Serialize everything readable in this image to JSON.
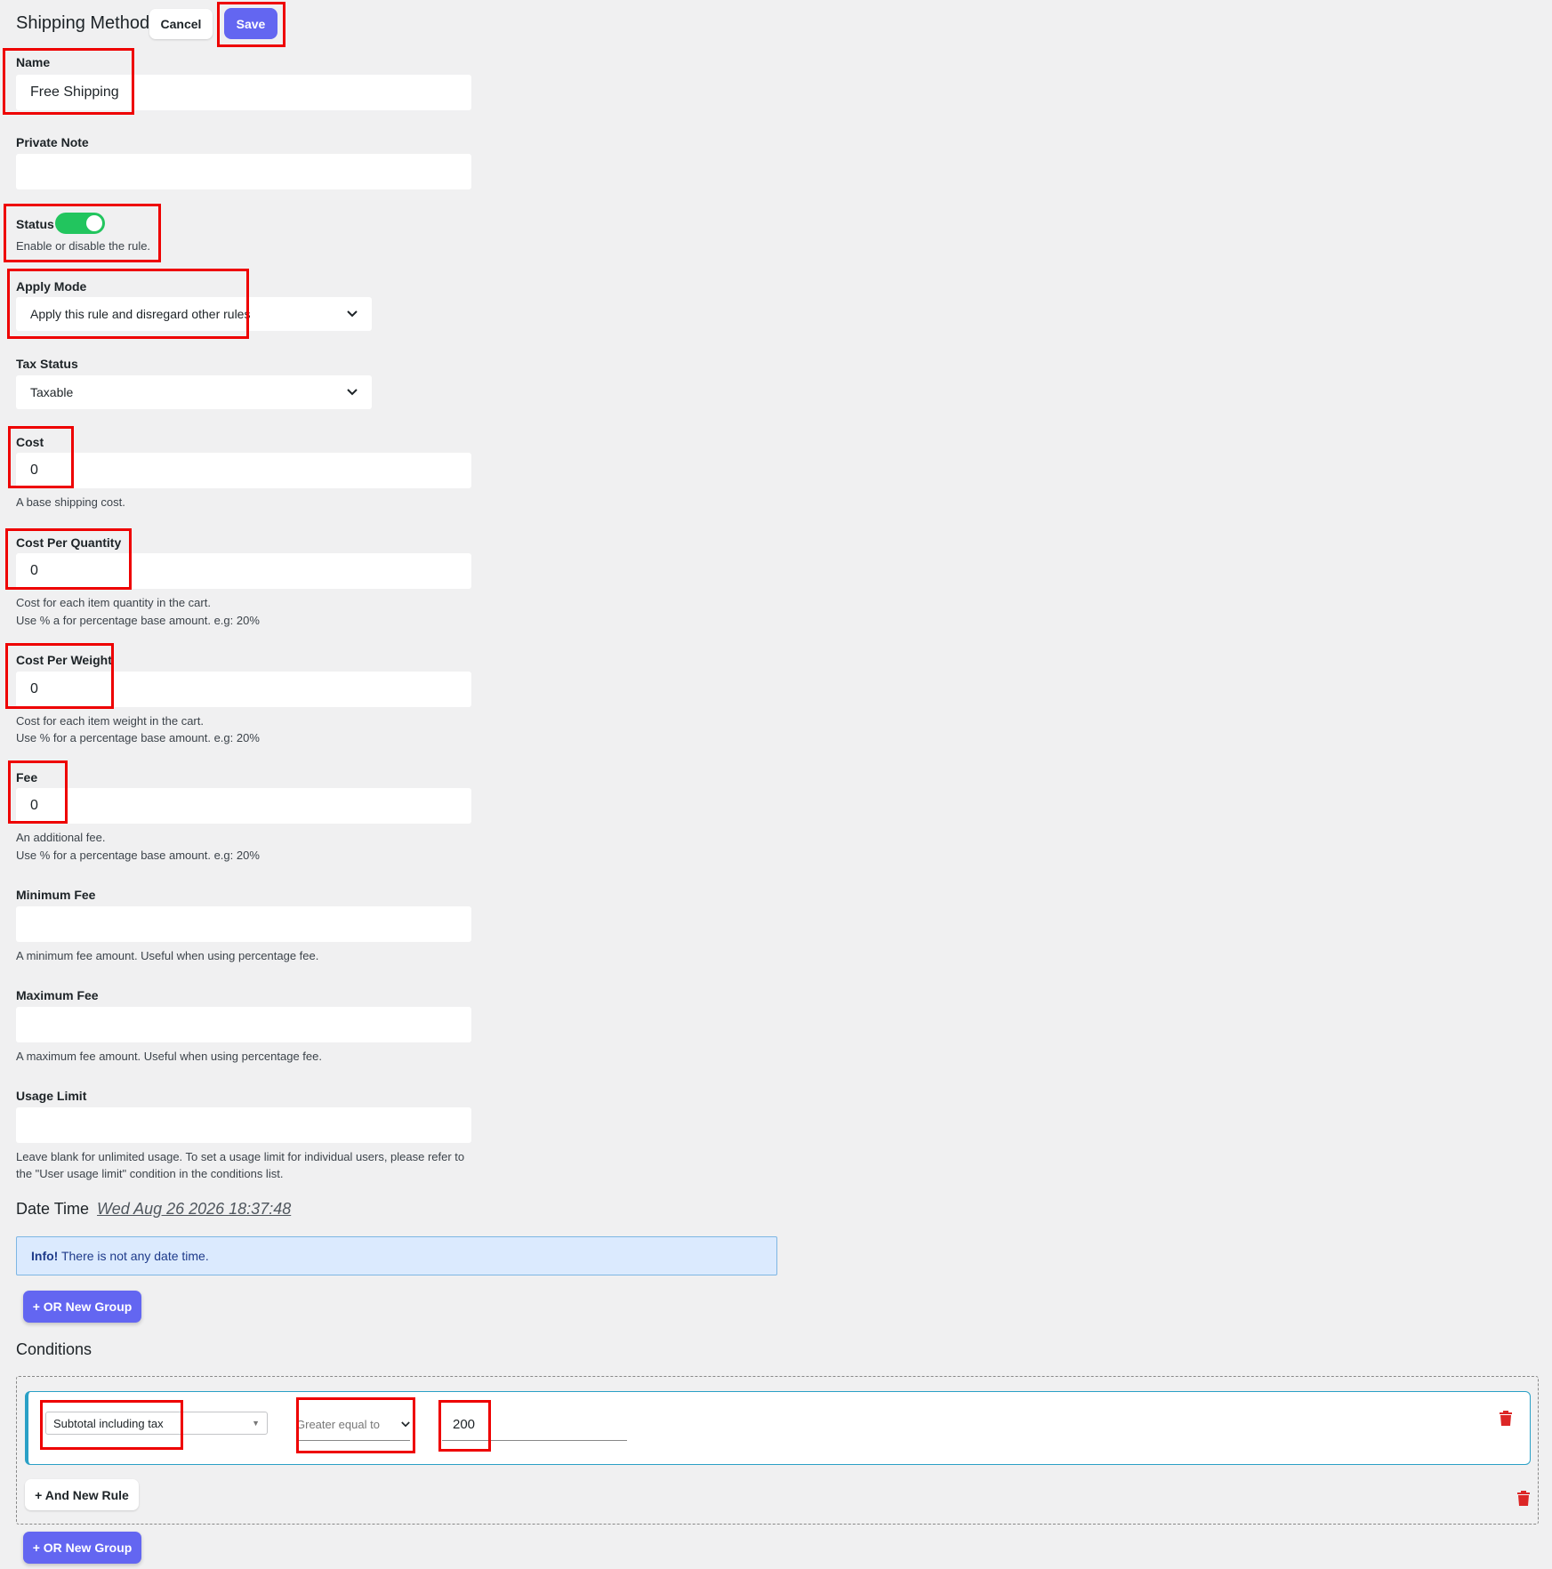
{
  "header": {
    "title": "Shipping Method",
    "cancel_label": "Cancel",
    "save_label": "Save"
  },
  "fields": {
    "name": {
      "label": "Name",
      "value": "Free Shipping"
    },
    "private_note": {
      "label": "Private Note",
      "value": ""
    },
    "status": {
      "label": "Status",
      "enabled": true,
      "help": "Enable or disable the rule."
    },
    "apply_mode": {
      "label": "Apply Mode",
      "value": "Apply this rule and disregard other rules"
    },
    "tax_status": {
      "label": "Tax Status",
      "value": "Taxable"
    },
    "cost": {
      "label": "Cost",
      "value": "0",
      "help": "A base shipping cost."
    },
    "cost_per_quantity": {
      "label": "Cost Per Quantity",
      "value": "0",
      "help1": "Cost for each item quantity in the cart.",
      "help2": "Use % a for percentage base amount. e.g: 20%"
    },
    "cost_per_weight": {
      "label": "Cost Per Weight",
      "value": "0",
      "help1": "Cost for each item weight in the cart.",
      "help2": "Use % for a percentage base amount. e.g: 20%"
    },
    "fee": {
      "label": "Fee",
      "value": "0",
      "help1": "An additional fee.",
      "help2": "Use % for a percentage base amount. e.g: 20%"
    },
    "minimum_fee": {
      "label": "Minimum Fee",
      "value": "",
      "help": "A minimum fee amount. Useful when using percentage fee."
    },
    "maximum_fee": {
      "label": "Maximum Fee",
      "value": "",
      "help": "A maximum fee amount. Useful when using percentage fee."
    },
    "usage_limit": {
      "label": "Usage Limit",
      "value": "",
      "help1": "Leave blank for unlimited usage. To set a usage limit for individual users, please refer to",
      "help2": "the \"User usage limit\" condition in the conditions list."
    }
  },
  "date_time": {
    "title": "Date Time",
    "timestamp": "Wed Aug 26 2026 18:37:48",
    "info_strong": "Info!",
    "info_text": " There is not any date time.",
    "or_new_group_label": "+ OR New Group"
  },
  "conditions": {
    "title": "Conditions",
    "rule": {
      "type": "Subtotal including tax",
      "operator": "Greater equal to",
      "value": "200"
    },
    "and_new_rule_label": "+ And New Rule",
    "or_new_group_label": "+ OR New Group"
  },
  "icons": {
    "trash": "trash-icon",
    "chevron": "chevron-down-icon",
    "caret": "caret-down-icon"
  },
  "colors": {
    "primary": "#6366f1",
    "toggle_on": "#22c55e",
    "highlight": "#e00000",
    "rule_border": "#2aa0c6",
    "danger": "#dc2626"
  }
}
